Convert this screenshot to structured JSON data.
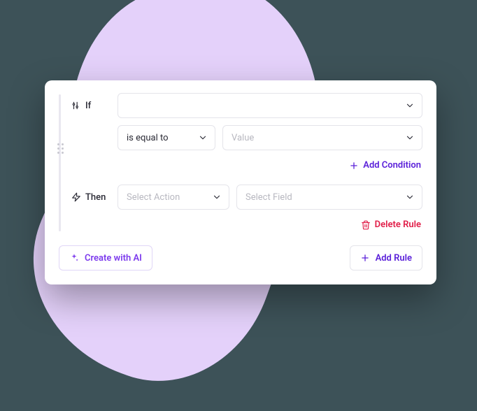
{
  "rule": {
    "if_label": "If",
    "then_label": "Then",
    "condition_operator": "is equal to",
    "condition_value_placeholder": "Value",
    "action_placeholder": "Select Action",
    "field_placeholder": "Select Field",
    "add_condition_label": "Add Condition",
    "delete_rule_label": "Delete Rule"
  },
  "footer": {
    "create_ai_label": "Create with AI",
    "add_rule_label": "Add Rule"
  },
  "colors": {
    "accent": "#5b21d9",
    "danger": "#e11d48",
    "blob": "#e4d1fa"
  }
}
